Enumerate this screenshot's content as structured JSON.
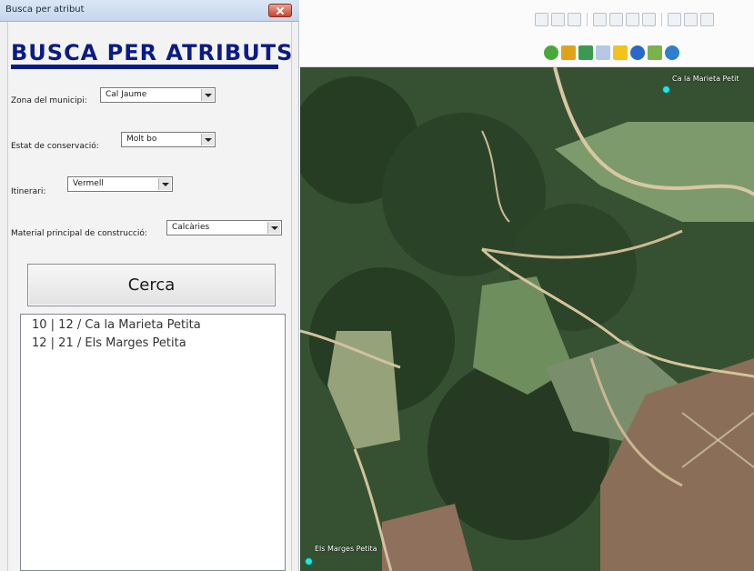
{
  "window": {
    "title": "Busca per atribut",
    "close_icon": "close-icon"
  },
  "heading": "BUSCA PER ATRIBUTS",
  "form": {
    "zona": {
      "label": "Zona del municipi:",
      "value": "Cal Jaume"
    },
    "estat": {
      "label": "Estat de conservació:",
      "value": "Molt bo"
    },
    "itinerari": {
      "label": "Itinerari:",
      "value": "Vermell"
    },
    "material": {
      "label": "Material principal de construcció:",
      "value": "Calcàries"
    }
  },
  "search_button": "Cerca",
  "results": [
    "10 | 12 / Ca la Marieta Petita",
    "12 | 21 / Els Marges Petita"
  ],
  "map": {
    "labels": {
      "top_right": "Ca la Marieta Petit",
      "bottom_left": "Els Marges Petita"
    },
    "marker_color": "#21e6e6"
  },
  "colors": {
    "heading": "#0b1b86"
  }
}
